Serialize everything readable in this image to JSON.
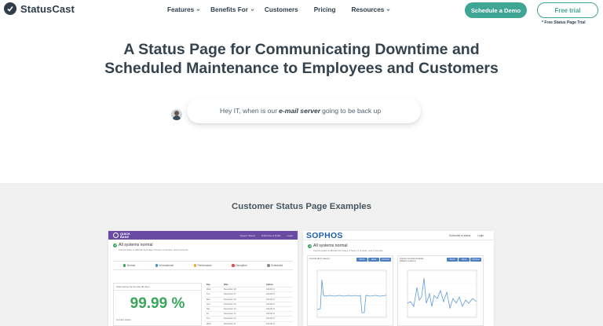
{
  "header": {
    "logo_text": "StatusCast",
    "nav": {
      "features": "Features",
      "benefits": "Benefits For",
      "customers": "Customers",
      "pricing": "Pricing",
      "resources": "Resources"
    },
    "demo_button": "Schedule a Demo",
    "trial_button": "Free trial",
    "trial_note": "* Free Status Page Trial"
  },
  "hero": {
    "title_line1": "A Status Page for Communicating Downtime and",
    "title_line2": "Scheduled Maintenance to Employees and Customers",
    "chat_before": "Hey IT, when is our",
    "chat_emphasis": "e-mail server",
    "chat_after": "going to be back up"
  },
  "examples": {
    "title": "Customer Status Page Examples",
    "quickbase": {
      "logo_line1": "QUICK",
      "logo_line2": "BASE",
      "links": [
        "System Status",
        "Subscribe & Notify",
        "Login"
      ],
      "status": "All systems normal",
      "sub": "Current status is affected by 0 days, 0 hours, 0 minutes, and 0 seconds.",
      "legend": [
        {
          "label": "Normal",
          "color": "#3aa55b"
        },
        {
          "label": "Informational",
          "color": "#4a8fd1"
        },
        {
          "label": "Performance",
          "color": "#f0a830"
        },
        {
          "label": "Disruption",
          "color": "#e04a4a"
        },
        {
          "label": "Scheduled",
          "color": "#8a8a8a"
        }
      ],
      "uptime_label": "Total uptime for the last 90 days",
      "uptime_value": "99.99 %",
      "current_label": "Current status",
      "table_head": [
        "Day",
        "Date",
        "Uptime"
      ],
      "table_rows": [
        [
          "Wed",
          "November 18",
          "100.00 %"
        ],
        [
          "Tue",
          "November 17",
          "100.00 %"
        ],
        [
          "Mon",
          "November 16",
          "100.00 %"
        ],
        [
          "Sun",
          "November 15",
          "100.00 %"
        ],
        [
          "Sat",
          "November 14",
          "100.00 %"
        ],
        [
          "Fri",
          "November 13",
          "100.00 %"
        ],
        [
          "Thu",
          "November 12",
          "100.00 %"
        ],
        [
          "Wed",
          "November 11",
          "100.00 %"
        ]
      ]
    },
    "sophos": {
      "logo": "SOPHOS",
      "links": [
        "Subscribe to status",
        "Login"
      ],
      "status": "All systems normal",
      "sub": "Current status is affected for 0 days, 0 hours, 0 minutes, and 0 seconds.",
      "chart_left_label": "Central (EU) Latency",
      "chart_right_label": "Sophos Central Analysis Platform Latency",
      "chart_buttons": [
        "Month",
        "Week",
        "24 Hours"
      ]
    }
  }
}
